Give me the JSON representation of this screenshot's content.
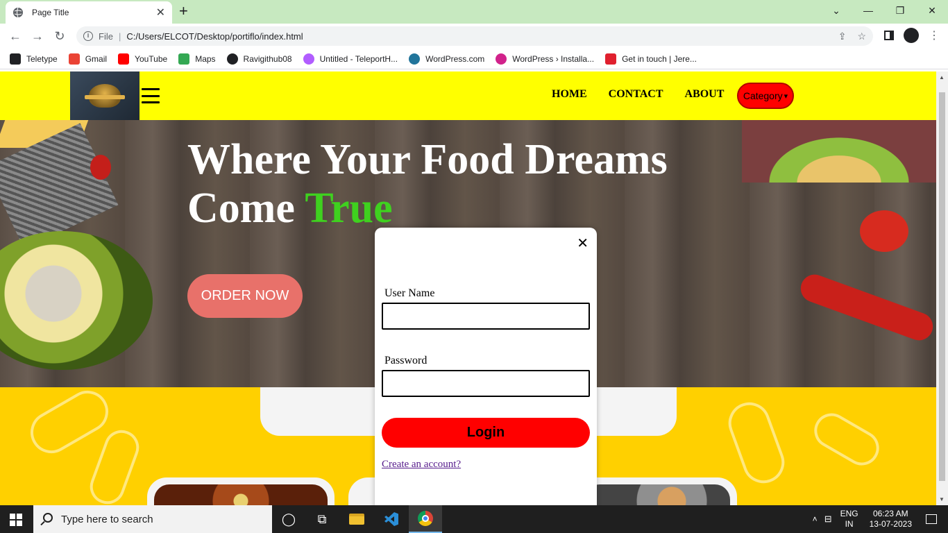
{
  "browser": {
    "tab_title": "Page Title",
    "file_label": "File",
    "url": "C:/Users/ELCOT/Desktop/portiflo/index.html",
    "bookmarks": [
      {
        "label": "Teletype",
        "color": "#202124"
      },
      {
        "label": "Gmail",
        "color": "#ea4335"
      },
      {
        "label": "YouTube",
        "color": "#ff0000"
      },
      {
        "label": "Maps",
        "color": "#34a853"
      },
      {
        "label": "Ravigithub08",
        "color": "#202124"
      },
      {
        "label": "Untitled - TeleportH...",
        "color": "#b15dff"
      },
      {
        "label": "WordPress.com",
        "color": "#21759b"
      },
      {
        "label": "WordPress › Installa...",
        "color": "#d1228b"
      },
      {
        "label": "Get in touch | Jere...",
        "color": "#e0202e"
      }
    ]
  },
  "site": {
    "nav": {
      "links": [
        "HOME",
        "CONTACT",
        "ABOUT"
      ],
      "category_label": "Category"
    },
    "hero": {
      "title_line1": "Where Your Food Dreams",
      "title_line2_prefix": "Come ",
      "title_accent": "True",
      "order_button": "ORDER NOW"
    },
    "colors": {
      "nav_bg": "#ffff00",
      "accent_green": "#3fd11f",
      "order_button": "#e8716a",
      "login_button": "#ff0000",
      "section_bg": "#ffd000"
    }
  },
  "modal": {
    "username_label": "User Name",
    "password_label": "Password",
    "login_button": "Login",
    "create_account_link": "Create an account?"
  },
  "taskbar": {
    "search_placeholder": "Type here to search",
    "lang_line1": "ENG",
    "lang_line2": "IN",
    "time": "06:23 AM",
    "date": "13-07-2023"
  }
}
